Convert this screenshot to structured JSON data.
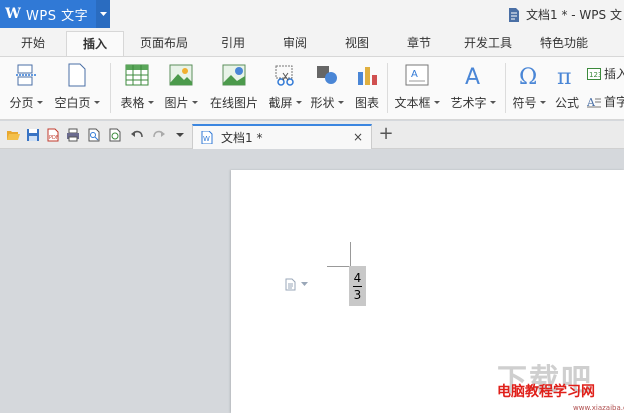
{
  "app": {
    "logo_letter": "W",
    "name": "WPS 文字",
    "window_title": "文档1 * - WPS 文"
  },
  "tabs": [
    "开始",
    "插入",
    "页面布局",
    "引用",
    "审阅",
    "视图",
    "章节",
    "开发工具",
    "特色功能"
  ],
  "active_tab": "插入",
  "ribbon": {
    "page_break": "分页",
    "blank_page": "空白页",
    "table": "表格",
    "picture": "图片",
    "online_picture": "在线图片",
    "screenshot": "截屏",
    "shape": "形状",
    "chart": "图表",
    "textbox": "文本框",
    "wordart": "艺术字",
    "symbol": "符号",
    "formula": "公式",
    "insert_number": "插入",
    "header_footer": "首字"
  },
  "doc_tab": {
    "name": "文档1 *",
    "close": "×"
  },
  "new_tab": "+",
  "document": {
    "numerator": "4",
    "denominator": "3"
  },
  "watermark": {
    "big": "下载吧",
    "small": "电脑教程学习网",
    "url": "www.xiazaiba.com"
  },
  "colors": {
    "accent": "#3079d6",
    "tab_active_border": "#3b86e0",
    "workspace": "#d5d8dc"
  }
}
